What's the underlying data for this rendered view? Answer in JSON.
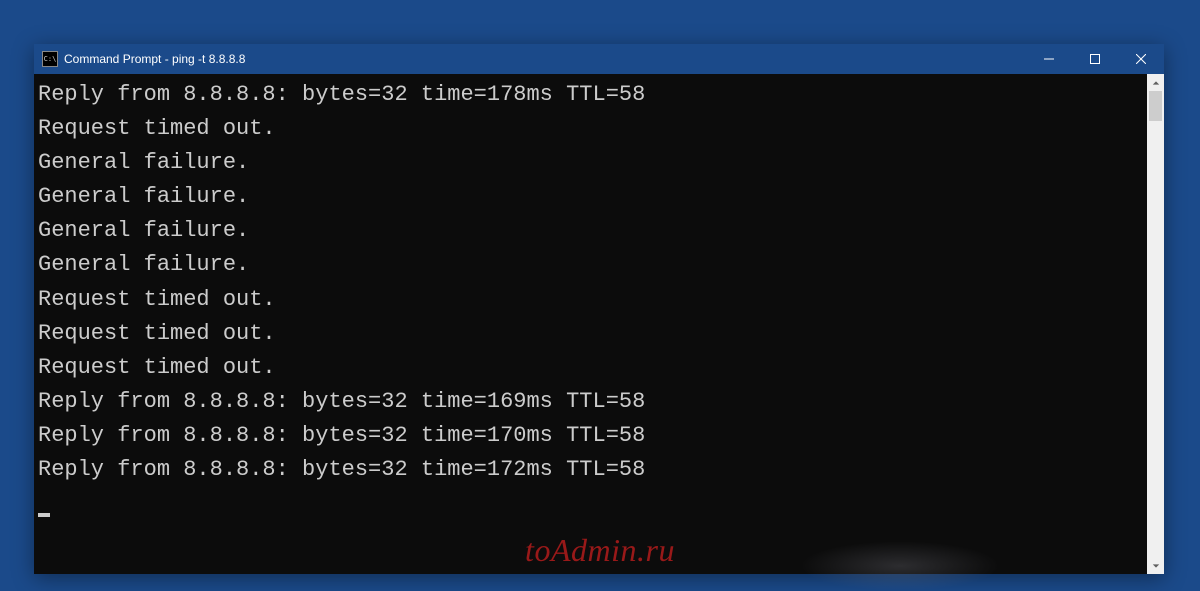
{
  "window": {
    "title": "Command Prompt - ping  -t 8.8.8.8",
    "icon_label": "C:\\"
  },
  "console": {
    "lines": [
      "Reply from 8.8.8.8: bytes=32 time=178ms TTL=58",
      "Request timed out.",
      "General failure.",
      "General failure.",
      "General failure.",
      "General failure.",
      "Request timed out.",
      "Request timed out.",
      "Request timed out.",
      "Reply from 8.8.8.8: bytes=32 time=169ms TTL=58",
      "Reply from 8.8.8.8: bytes=32 time=170ms TTL=58",
      "Reply from 8.8.8.8: bytes=32 time=172ms TTL=58"
    ]
  },
  "watermark": "toAdmin.ru"
}
